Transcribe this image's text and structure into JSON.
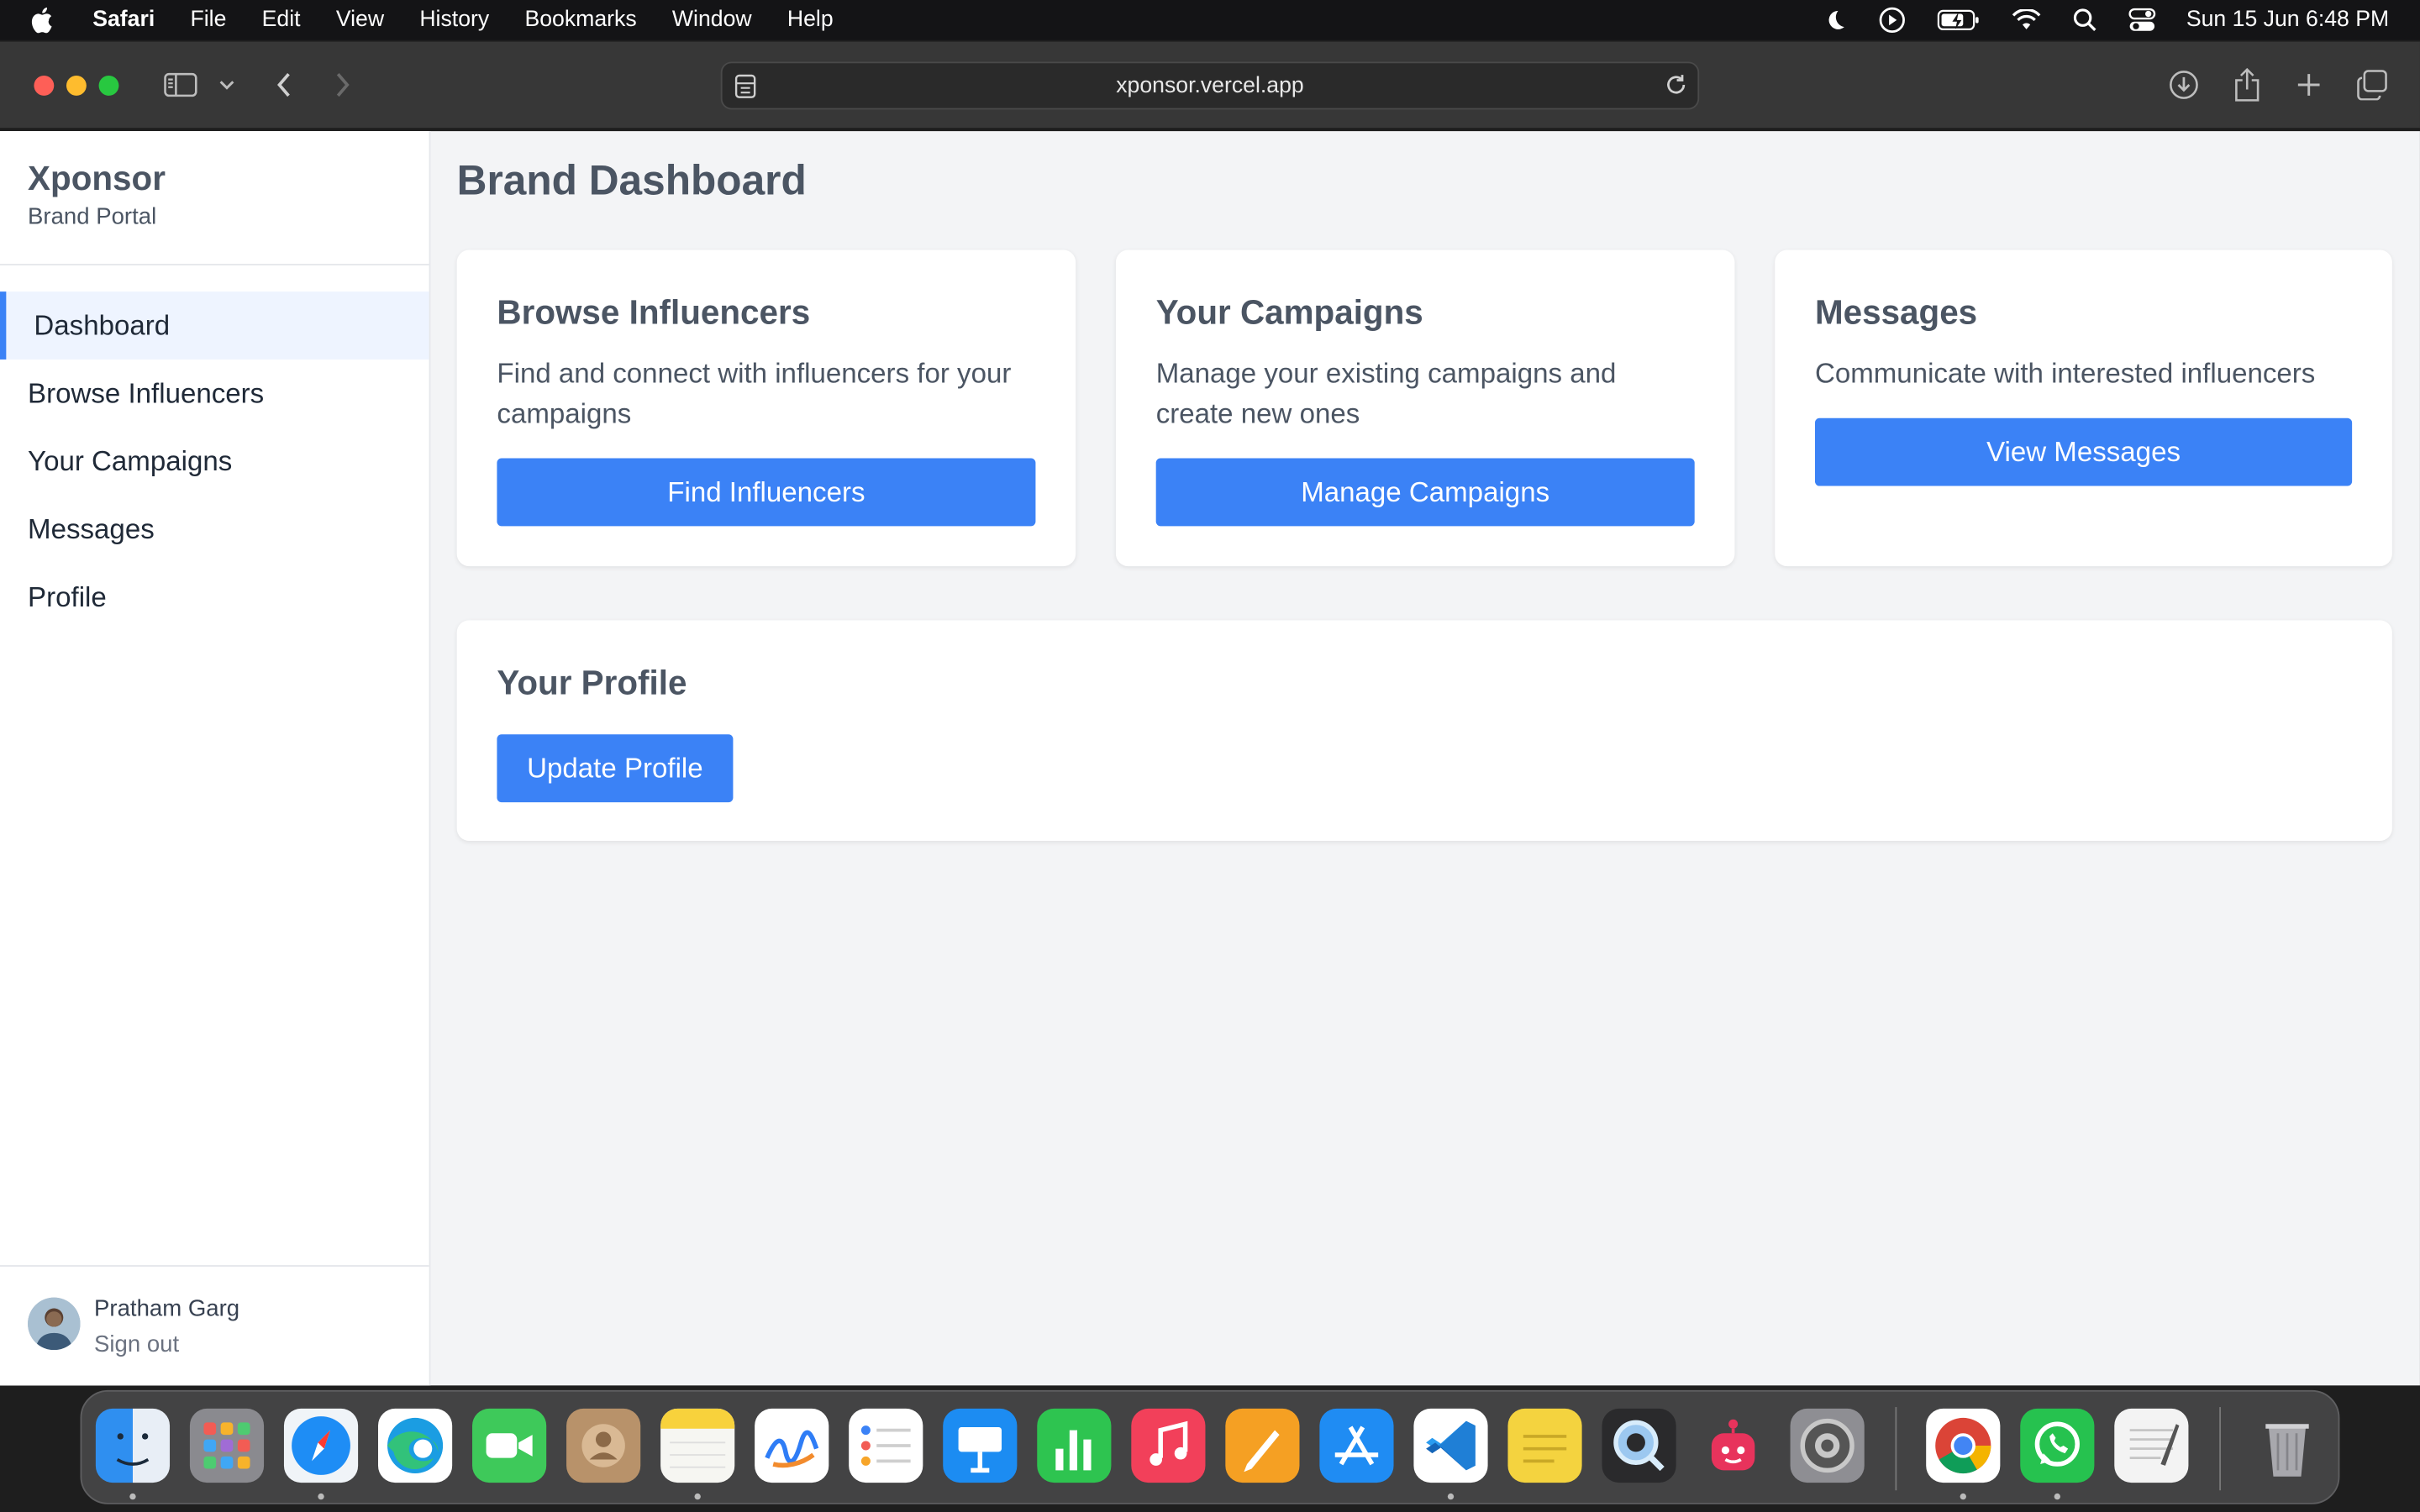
{
  "menubar": {
    "app": "Safari",
    "items": [
      "File",
      "Edit",
      "View",
      "History",
      "Bookmarks",
      "Window",
      "Help"
    ],
    "clock": "Sun 15 Jun  6:48 PM",
    "status_icons": [
      "moon-icon",
      "play-icon",
      "battery-icon",
      "wifi-icon",
      "search-icon",
      "control-center-icon"
    ]
  },
  "browser": {
    "url": "xponsor.vercel.app"
  },
  "sidebar": {
    "brand": "Xponsor",
    "subtitle": "Brand Portal",
    "items": [
      {
        "label": "Dashboard",
        "active": true
      },
      {
        "label": "Browse Influencers",
        "active": false
      },
      {
        "label": "Your Campaigns",
        "active": false
      },
      {
        "label": "Messages",
        "active": false
      },
      {
        "label": "Profile",
        "active": false
      }
    ],
    "user": {
      "name": "Pratham Garg",
      "signout": "Sign out"
    }
  },
  "main": {
    "title": "Brand Dashboard",
    "cards": [
      {
        "title": "Browse Influencers",
        "description": "Find and connect with influencers for your campaigns",
        "button": "Find Influencers"
      },
      {
        "title": "Your Campaigns",
        "description": "Manage your existing campaigns and create new ones",
        "button": "Manage Campaigns"
      },
      {
        "title": "Messages",
        "description": "Communicate with interested influencers",
        "button": "View Messages"
      }
    ],
    "profile_card": {
      "title": "Your Profile",
      "button": "Update Profile"
    }
  },
  "colors": {
    "accent": "#3b82f6",
    "active_bg": "#eef4ff",
    "page_bg": "#f3f4f6"
  },
  "dock": {
    "apps": [
      "Finder",
      "Launchpad",
      "Safari",
      "Edge",
      "FaceTime",
      "Contacts",
      "Notes",
      "Freeform",
      "Reminders",
      "Keynote",
      "Numbers",
      "Music",
      "Pages",
      "App Store",
      "VS Code",
      "Stickies",
      "QuickTime",
      "Bot",
      "System Settings",
      "Chrome",
      "WhatsApp",
      "TextEdit",
      "Trash"
    ]
  }
}
